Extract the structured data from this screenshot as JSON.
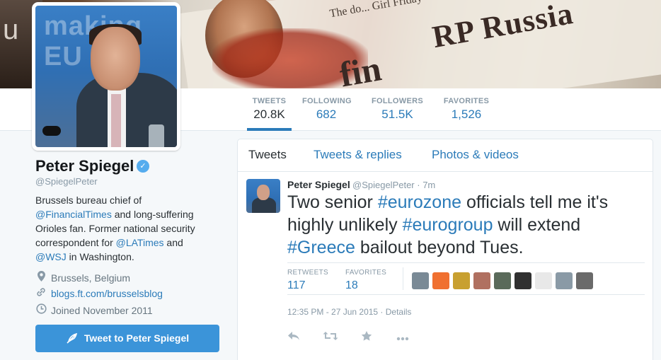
{
  "banner": {
    "text_a": "RP Russia",
    "text_b": "fin",
    "text_c": "The do... Girl Friday",
    "text_left": "u"
  },
  "avatar_text": "making EU",
  "nav": {
    "stats": [
      {
        "label": "TWEETS",
        "value": "20.8K"
      },
      {
        "label": "FOLLOWING",
        "value": "682"
      },
      {
        "label": "FOLLOWERS",
        "value": "51.5K"
      },
      {
        "label": "FAVORITES",
        "value": "1,526"
      }
    ]
  },
  "profile": {
    "name": "Peter Spiegel",
    "handle": "@SpiegelPeter",
    "bio_1": "Brussels bureau chief of",
    "bio_link_1": "@FinancialTimes",
    "bio_2": " and long-suffering Orioles fan. Former national security correspondent for ",
    "bio_link_2": "@LATimes",
    "bio_3": " and",
    "bio_link_3": "@WSJ",
    "bio_4": " in Washington.",
    "location": "Brussels, Belgium",
    "website": "blogs.ft.com/brusselsblog",
    "joined": "Joined November 2011",
    "tweet_to_label": "Tweet to Peter Spiegel"
  },
  "tabs": [
    "Tweets",
    "Tweets & replies",
    "Photos & videos"
  ],
  "tweet": {
    "name": "Peter Spiegel",
    "handle_time": "@SpiegelPeter · 7m",
    "text_1": "Two senior ",
    "tag_1": "#eurozone",
    "text_2": " officials tell me it's highly unlikely ",
    "tag_2": "#eurogroup",
    "text_3": " will extend ",
    "tag_3": "#Greece",
    "text_4": " bailout beyond Tues.",
    "retweets_label": "RETWEETS",
    "retweets": "117",
    "favorites_label": "FAVORITES",
    "favorites": "18",
    "date": "12:35 PM - 27 Jun 2015 · ",
    "details": "Details"
  },
  "favoriters": [
    {
      "name": "favoriter-1",
      "color": "#7a8a96"
    },
    {
      "name": "favoriter-2",
      "color": "#f07030"
    },
    {
      "name": "favoriter-3",
      "color": "#c8a030"
    },
    {
      "name": "favoriter-4",
      "color": "#b07060"
    },
    {
      "name": "favoriter-5",
      "color": "#5a6a5a"
    },
    {
      "name": "favoriter-6",
      "color": "#303030"
    },
    {
      "name": "favoriter-7",
      "color": "#e8e8e8"
    },
    {
      "name": "favoriter-8",
      "color": "#8a9aa6"
    },
    {
      "name": "favoriter-9",
      "color": "#6a6a6a"
    }
  ],
  "icons": {
    "verified": "check-icon",
    "location": "map-pin-icon",
    "link": "link-icon",
    "calendar": "calendar-icon",
    "compose": "quill-icon",
    "reply": "reply-icon",
    "retweet": "retweet-icon",
    "favorite": "star-icon",
    "more": "more-icon"
  }
}
